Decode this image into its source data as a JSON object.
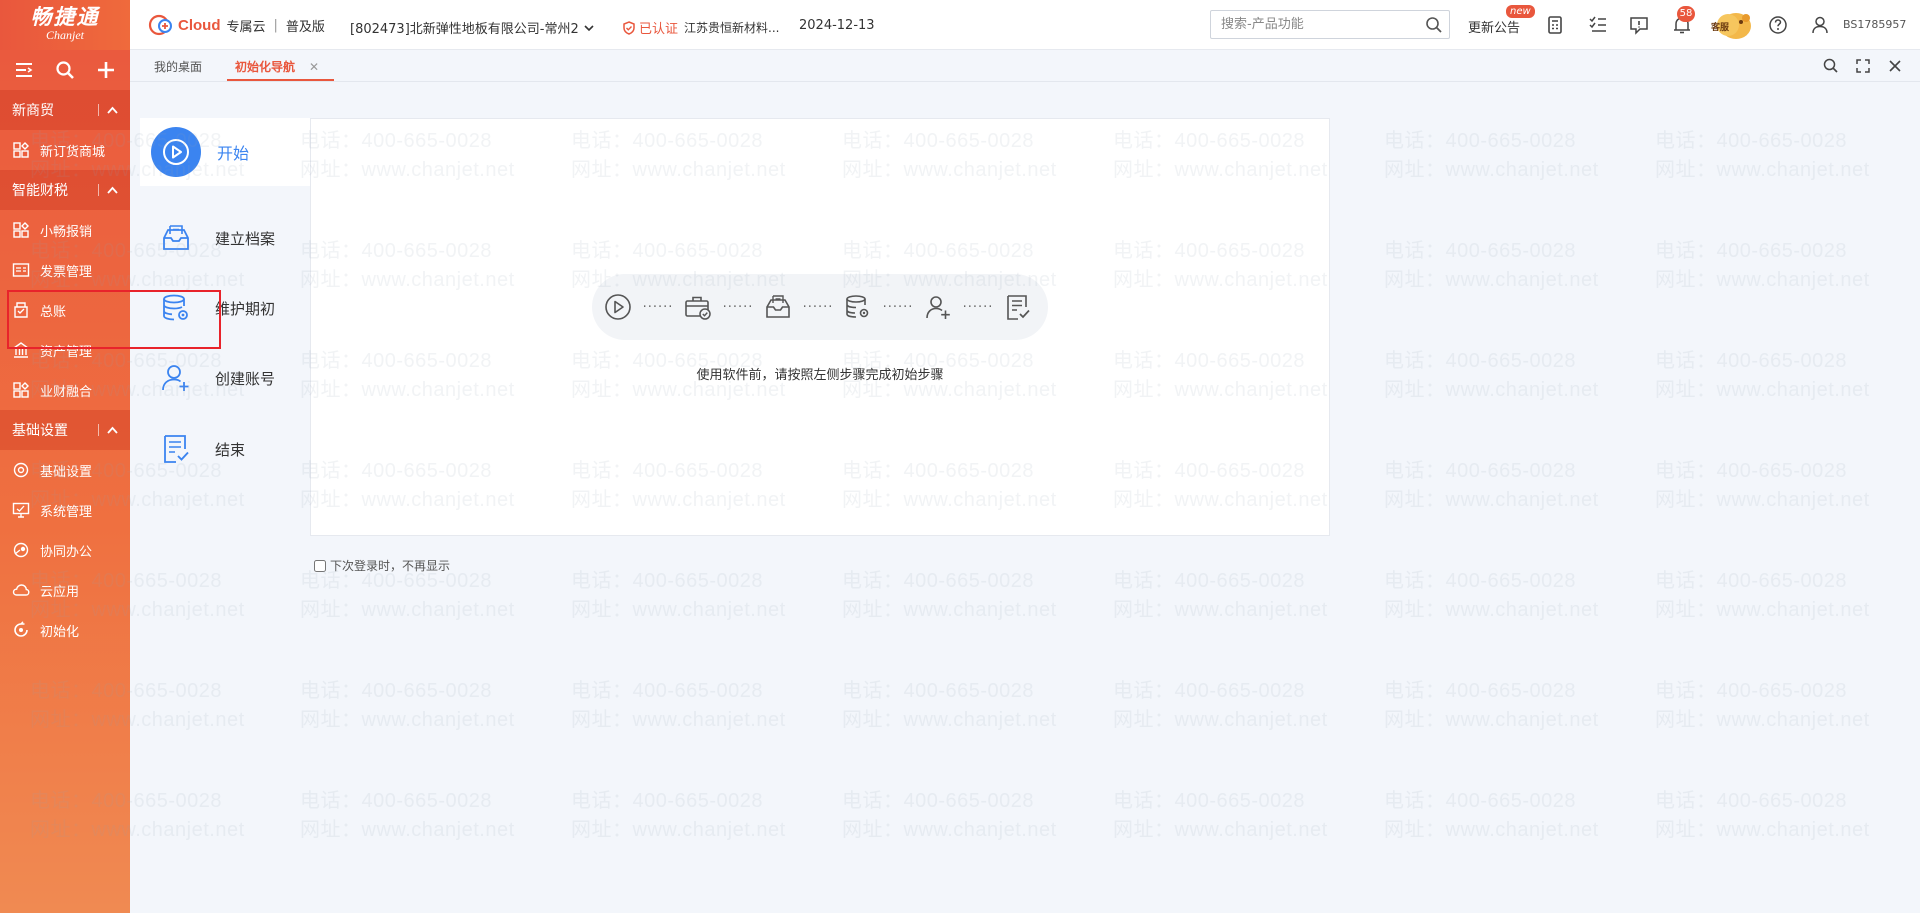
{
  "logo": {
    "cn": "畅捷通",
    "en": "Chanjet"
  },
  "brand": {
    "cloud": "Cloud",
    "edition_type": "专属云",
    "separator": "|",
    "edition": "普及版"
  },
  "company": {
    "name": "[802473]北新弹性地板有限公司-常州2"
  },
  "certification": {
    "label": "已认证",
    "company": "江苏贵恒新材料..."
  },
  "date": "2024-12-13",
  "search": {
    "placeholder": "搜索-产品功能"
  },
  "notice": {
    "label": "更新公告",
    "badge": "new"
  },
  "notifications": {
    "count": "58"
  },
  "service": {
    "label": "客服"
  },
  "user": {
    "id": "BS1785957"
  },
  "sidebar": {
    "groups": [
      {
        "title": "新商贸",
        "items": [
          {
            "label": "新订货商城",
            "icon": "store-icon"
          }
        ]
      },
      {
        "title": "智能财税",
        "items": [
          {
            "label": "小畅报销",
            "icon": "expense-icon"
          },
          {
            "label": "发票管理",
            "icon": "invoice-icon"
          },
          {
            "label": "总账",
            "icon": "ledger-icon"
          },
          {
            "label": "资产管理",
            "icon": "asset-icon"
          },
          {
            "label": "业财融合",
            "icon": "finance-icon"
          }
        ]
      },
      {
        "title": "基础设置",
        "items": [
          {
            "label": "基础设置",
            "icon": "settings-icon"
          },
          {
            "label": "系统管理",
            "icon": "system-icon"
          },
          {
            "label": "协同办公",
            "icon": "collab-icon"
          },
          {
            "label": "云应用",
            "icon": "cloud-icon"
          },
          {
            "label": "初始化",
            "icon": "init-icon"
          }
        ]
      }
    ]
  },
  "tabs": [
    {
      "label": "我的桌面",
      "active": false
    },
    {
      "label": "初始化导航",
      "active": true,
      "close": "✕"
    }
  ],
  "steps": {
    "start": "开始",
    "items": [
      "建立档案",
      "维护期初",
      "创建账号",
      "结束"
    ]
  },
  "flow": {
    "dots": "······"
  },
  "hint": "使用软件前，请按照左侧步骤完成初始步骤",
  "no_show": {
    "label": "下次登录时，不再显示",
    "checked": false
  },
  "watermark": {
    "phone": "电话：400-665-0028",
    "url": "网址：www.chanjet.net"
  },
  "colors": {
    "accent": "#e9573d",
    "sidebar": "#ef6a3c",
    "step_active": "#3b84f0",
    "highlight": "#e8232b"
  }
}
